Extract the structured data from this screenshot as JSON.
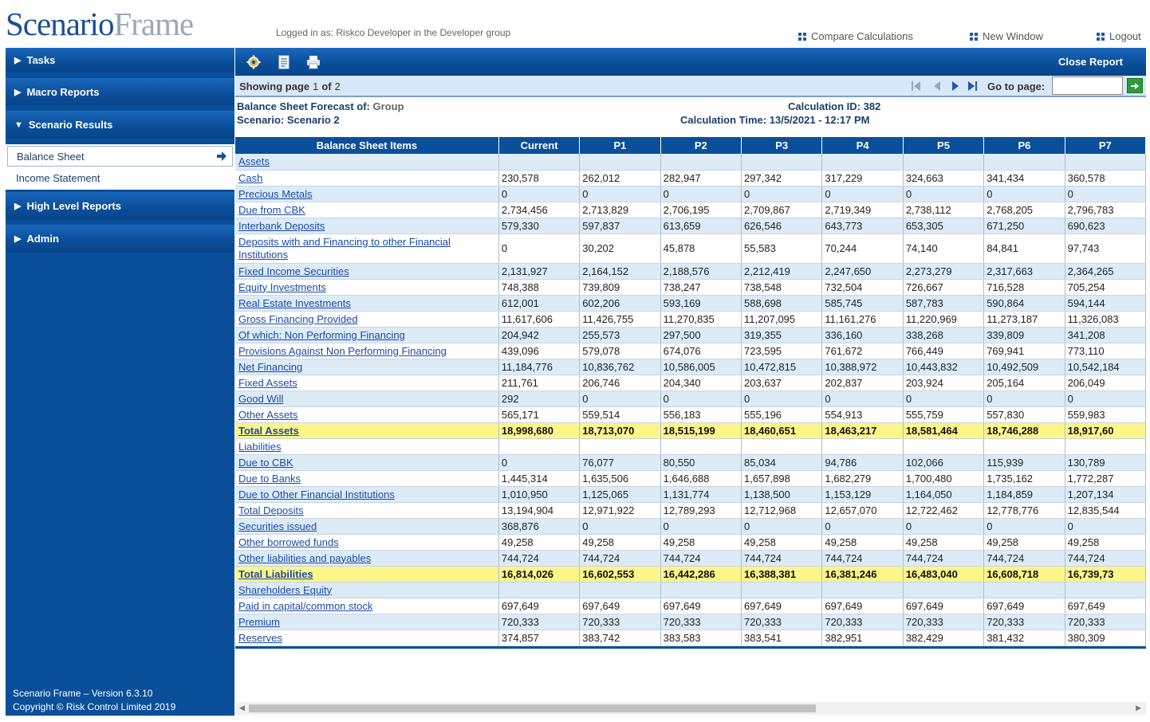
{
  "header": {
    "logo_part1": "Scenario",
    "logo_part2": "Frame",
    "login_info": "Logged in as: Riskco Developer in the Developer group",
    "links": {
      "compare": "Compare Calculations",
      "new_window": "New Window",
      "logout": "Logout"
    }
  },
  "sidebar": {
    "tasks": "Tasks",
    "macro_reports": "Macro Reports",
    "scenario_results": "Scenario Results",
    "sub_items": {
      "balance_sheet": "Balance Sheet",
      "income_statement": "Income Statement"
    },
    "high_level_reports": "High Level Reports",
    "admin": "Admin",
    "version": "Scenario Frame – Version 6.3.10",
    "copyright": "Copyright © Risk Control Limited 2019"
  },
  "toolbar": {
    "close_report": "Close Report"
  },
  "pager": {
    "showing_label": "Showing page",
    "current_page": "1",
    "of_label": "of",
    "total_pages": "2",
    "goto_label": "Go to page:",
    "goto_value": ""
  },
  "meta": {
    "forecast_label": "Balance Sheet Forecast of:",
    "forecast_value": "Group",
    "scenario_label": "Scenario:",
    "scenario_value": "Scenario 2",
    "calc_id_label": "Calculation ID:",
    "calc_id_value": "382",
    "calc_time_label": "Calculation Time:",
    "calc_time_value": "13/5/2021 - 12:17 PM"
  },
  "table": {
    "headers": [
      "Balance Sheet Items",
      "Current",
      "P1",
      "P2",
      "P3",
      "P4",
      "P5",
      "P6",
      "P7"
    ],
    "rows": [
      {
        "item": "Assets",
        "values": [
          "",
          "",
          "",
          "",
          "",
          "",
          "",
          ""
        ]
      },
      {
        "item": "Cash",
        "values": [
          "230,578",
          "262,012",
          "282,947",
          "297,342",
          "317,229",
          "324,663",
          "341,434",
          "360,578"
        ]
      },
      {
        "item": "Precious Metals",
        "values": [
          "0",
          "0",
          "0",
          "0",
          "0",
          "0",
          "0",
          "0"
        ]
      },
      {
        "item": "Due from CBK",
        "values": [
          "2,734,456",
          "2,713,829",
          "2,706,195",
          "2,709,867",
          "2,719,349",
          "2,738,112",
          "2,768,205",
          "2,796,783"
        ]
      },
      {
        "item": "Interbank Deposits",
        "values": [
          "579,330",
          "597,837",
          "613,659",
          "626,546",
          "643,773",
          "653,305",
          "671,250",
          "690,623"
        ]
      },
      {
        "item": "Deposits with and Financing to other Financial Institutions",
        "values": [
          "0",
          "30,202",
          "45,878",
          "55,583",
          "70,244",
          "74,140",
          "84,841",
          "97,743"
        ],
        "tall": true
      },
      {
        "item": "Fixed Income Securities",
        "values": [
          "2,131,927",
          "2,164,152",
          "2,188,576",
          "2,212,419",
          "2,247,650",
          "2,273,279",
          "2,317,663",
          "2,364,265"
        ]
      },
      {
        "item": "Equity Investments",
        "values": [
          "748,388",
          "739,809",
          "738,247",
          "738,548",
          "732,504",
          "726,667",
          "716,528",
          "705,254"
        ]
      },
      {
        "item": "Real Estate Investments",
        "values": [
          "612,001",
          "602,206",
          "593,169",
          "588,698",
          "585,745",
          "587,783",
          "590,864",
          "594,144"
        ]
      },
      {
        "item": "Gross Financing Provided",
        "values": [
          "11,617,606",
          "11,426,755",
          "11,270,835",
          "11,207,095",
          "11,161,276",
          "11,220,969",
          "11,273,187",
          "11,326,083"
        ]
      },
      {
        "item": "Of which: Non Performing Financing",
        "values": [
          "204,942",
          "255,573",
          "297,500",
          "319,355",
          "336,160",
          "338,268",
          "339,809",
          "341,208"
        ]
      },
      {
        "item": "Provisions Against Non Performing Financing",
        "values": [
          "439,096",
          "579,078",
          "674,076",
          "723,595",
          "761,672",
          "766,449",
          "769,941",
          "773,110"
        ]
      },
      {
        "item": "Net Financing",
        "values": [
          "11,184,776",
          "10,836,762",
          "10,586,005",
          "10,472,815",
          "10,388,972",
          "10,443,832",
          "10,492,509",
          "10,542,184"
        ]
      },
      {
        "item": "Fixed Assets",
        "values": [
          "211,761",
          "206,746",
          "204,340",
          "203,637",
          "202,837",
          "203,924",
          "205,164",
          "206,049"
        ]
      },
      {
        "item": "Good Will",
        "values": [
          "292",
          "0",
          "0",
          "0",
          "0",
          "0",
          "0",
          "0"
        ]
      },
      {
        "item": "Other Assets",
        "values": [
          "565,171",
          "559,514",
          "556,183",
          "555,196",
          "554,913",
          "555,759",
          "557,830",
          "559,983"
        ]
      },
      {
        "item": "Total Assets",
        "values": [
          "18,998,680",
          "18,713,070",
          "18,515,199",
          "18,460,651",
          "18,463,217",
          "18,581,464",
          "18,746,288",
          "18,917,60"
        ],
        "total": true
      },
      {
        "item": "Liabilities",
        "values": [
          "",
          "",
          "",
          "",
          "",
          "",
          "",
          ""
        ]
      },
      {
        "item": "Due to CBK",
        "values": [
          "0",
          "76,077",
          "80,550",
          "85,034",
          "94,786",
          "102,066",
          "115,939",
          "130,789"
        ]
      },
      {
        "item": "Due to Banks",
        "values": [
          "1,445,314",
          "1,635,506",
          "1,646,688",
          "1,657,898",
          "1,682,279",
          "1,700,480",
          "1,735,162",
          "1,772,287"
        ]
      },
      {
        "item": "Due to Other Financial Institutions",
        "values": [
          "1,010,950",
          "1,125,065",
          "1,131,774",
          "1,138,500",
          "1,153,129",
          "1,164,050",
          "1,184,859",
          "1,207,134"
        ]
      },
      {
        "item": "Total Deposits",
        "values": [
          "13,194,904",
          "12,971,922",
          "12,789,293",
          "12,712,968",
          "12,657,070",
          "12,722,462",
          "12,778,776",
          "12,835,544"
        ]
      },
      {
        "item": "Securities issued",
        "values": [
          "368,876",
          "0",
          "0",
          "0",
          "0",
          "0",
          "0",
          "0"
        ]
      },
      {
        "item": "Other borrowed funds",
        "values": [
          "49,258",
          "49,258",
          "49,258",
          "49,258",
          "49,258",
          "49,258",
          "49,258",
          "49,258"
        ]
      },
      {
        "item": "Other liabilities and payables",
        "values": [
          "744,724",
          "744,724",
          "744,724",
          "744,724",
          "744,724",
          "744,724",
          "744,724",
          "744,724"
        ]
      },
      {
        "item": "Total Liabilities",
        "values": [
          "16,814,026",
          "16,602,553",
          "16,442,286",
          "16,388,381",
          "16,381,246",
          "16,483,040",
          "16,608,718",
          "16,739,73"
        ],
        "total": true
      },
      {
        "item": "Shareholders Equity",
        "values": [
          "",
          "",
          "",
          "",
          "",
          "",
          "",
          ""
        ]
      },
      {
        "item": "Paid in capital/common stock",
        "values": [
          "697,649",
          "697,649",
          "697,649",
          "697,649",
          "697,649",
          "697,649",
          "697,649",
          "697,649"
        ]
      },
      {
        "item": "Premium",
        "values": [
          "720,333",
          "720,333",
          "720,333",
          "720,333",
          "720,333",
          "720,333",
          "720,333",
          "720,333"
        ]
      },
      {
        "item": "Reserves",
        "values": [
          "374,857",
          "383,742",
          "383,583",
          "383,541",
          "382,951",
          "382,429",
          "381,432",
          "380,309"
        ]
      }
    ]
  }
}
